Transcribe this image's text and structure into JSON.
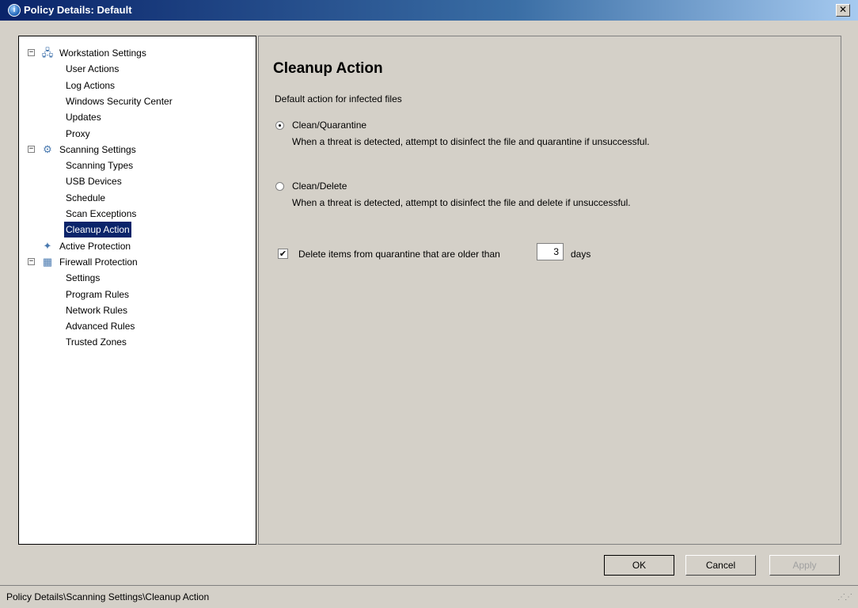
{
  "window": {
    "title": "Policy Details: Default",
    "close_label": "✕"
  },
  "tree": {
    "groups": [
      {
        "label": "Workstation Settings",
        "icon": "workstation-icon",
        "expander": "−",
        "children": [
          "User Actions",
          "Log Actions",
          "Windows Security Center",
          "Updates",
          "Proxy"
        ]
      },
      {
        "label": "Scanning Settings",
        "icon": "scanning-icon",
        "expander": "−",
        "children": [
          "Scanning Types",
          "USB Devices",
          "Schedule",
          "Scan Exceptions",
          "Cleanup Action"
        ]
      },
      {
        "label": "Active Protection",
        "icon": "active-protection-icon",
        "children": []
      },
      {
        "label": "Firewall Protection",
        "icon": "firewall-icon",
        "expander": "−",
        "children": [
          "Settings",
          "Program Rules",
          "Network Rules",
          "Advanced Rules",
          "Trusted Zones"
        ]
      }
    ],
    "selected": "Cleanup Action"
  },
  "content": {
    "heading": "Cleanup Action",
    "subtitle": "Default action for infected files",
    "options": [
      {
        "label": "Clean/Quarantine",
        "description": "When a threat is detected, attempt to disinfect the file and quarantine if unsuccessful.",
        "selected": true
      },
      {
        "label": "Clean/Delete",
        "description": "When a threat is detected, attempt to disinfect the file and delete if unsuccessful.",
        "selected": false
      }
    ],
    "quarantine": {
      "checked": true,
      "label": "Delete items from quarantine that are older than",
      "days_value": "3",
      "days_suffix": "days"
    }
  },
  "buttons": {
    "ok": "OK",
    "cancel": "Cancel",
    "apply": "Apply"
  },
  "status": {
    "path": "Policy Details\\Scanning Settings\\Cleanup Action"
  },
  "colors": {
    "titlebar": "#0a246a",
    "selection": "#0a246a",
    "window_bg": "#d4d0c8"
  }
}
